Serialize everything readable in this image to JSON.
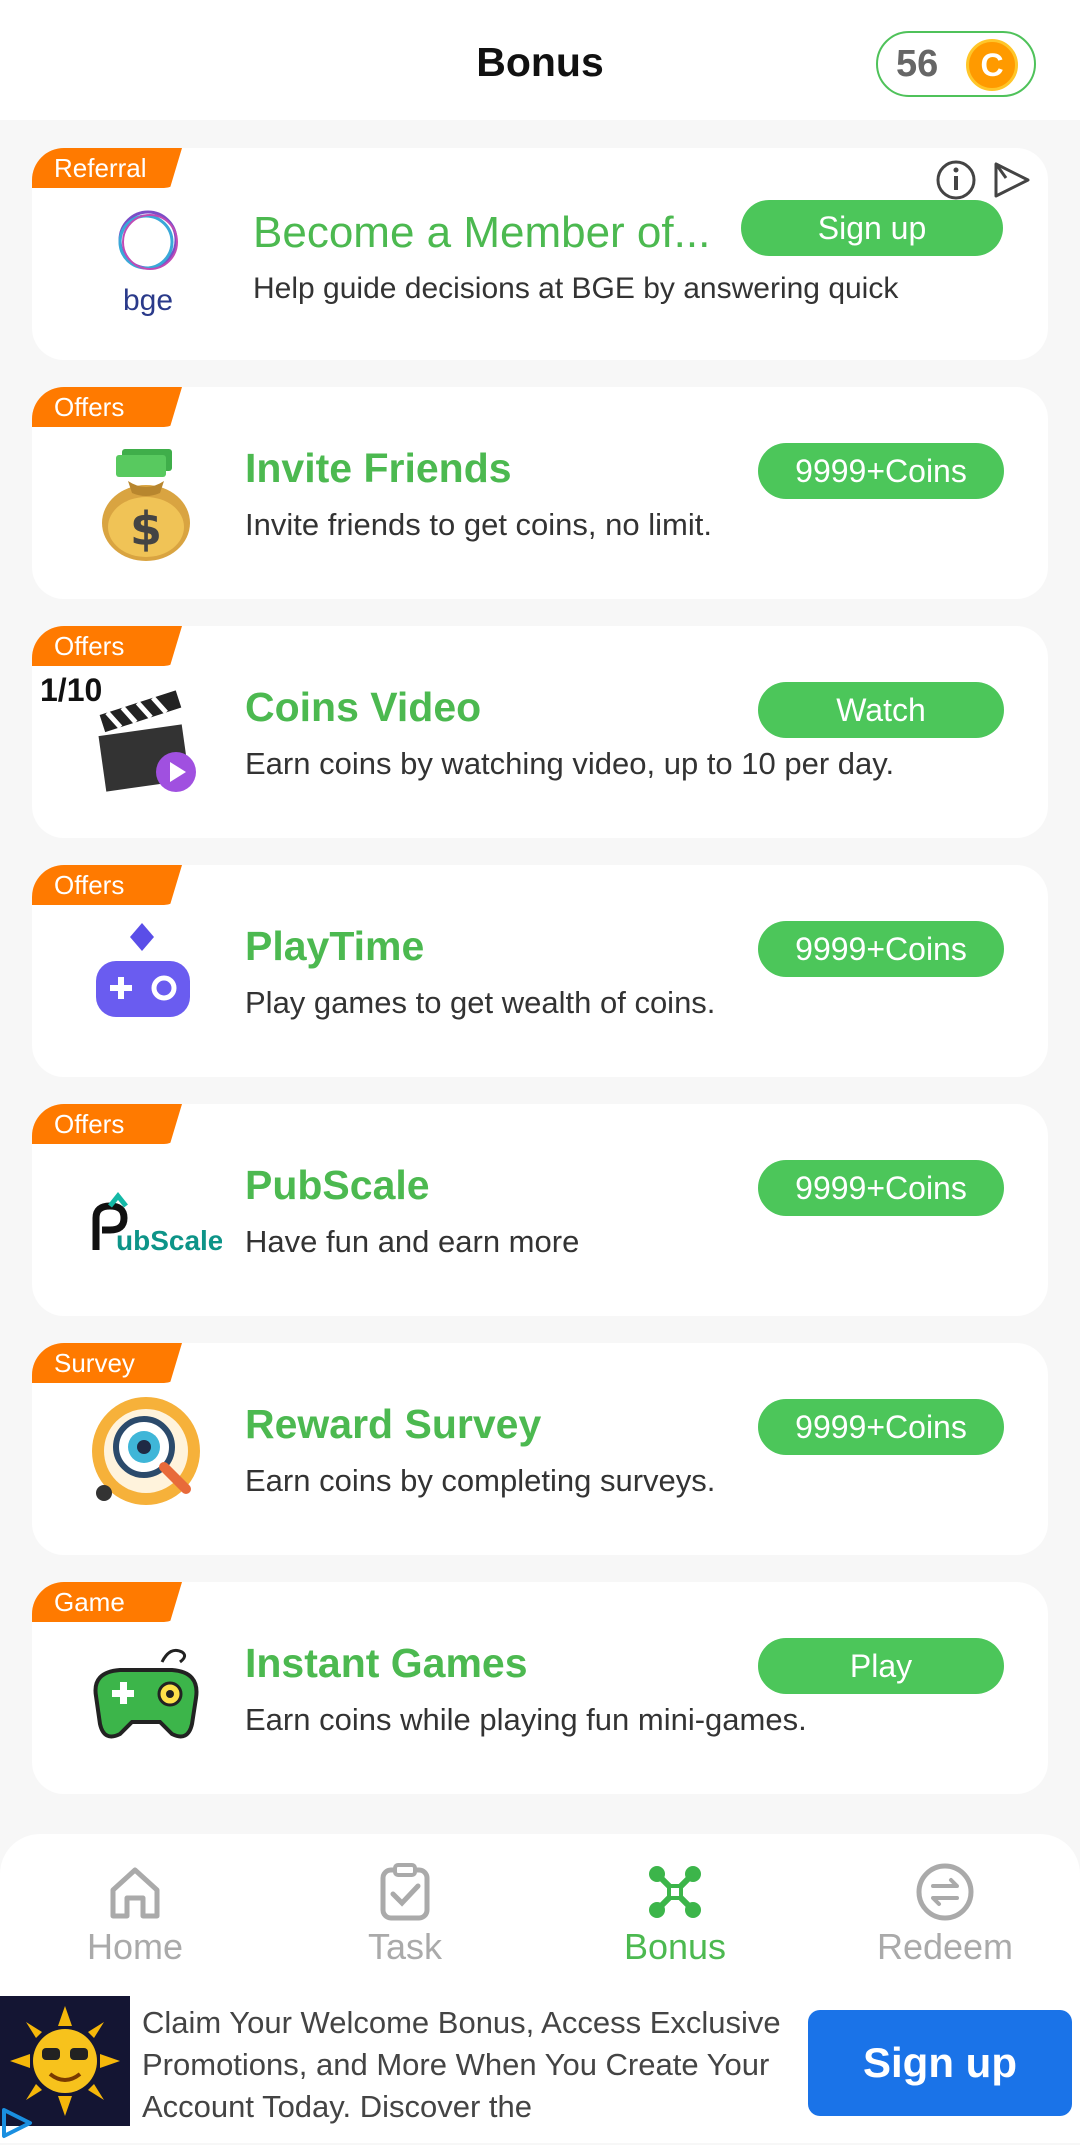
{
  "header": {
    "title": "Bonus",
    "coin_count": "56",
    "coin_symbol": "C"
  },
  "ad_card": {
    "tag": "Referral",
    "brand": "bge",
    "title": "Become a Member of...",
    "description": "Help guide decisions at BGE by answering quick",
    "button": "Sign up"
  },
  "cards": [
    {
      "tag": "Offers",
      "title": "Invite Friends",
      "description": "Invite friends to get coins, no limit.",
      "button": "9999+Coins",
      "icon": "money-bag-icon"
    },
    {
      "tag": "Offers",
      "title": "Coins Video",
      "description": "Earn coins by watching video, up to 10 per day.",
      "button": "Watch",
      "counter": "1/10",
      "icon": "clapperboard-icon"
    },
    {
      "tag": "Offers",
      "title": "PlayTime",
      "description": "Play games to get wealth of coins.",
      "button": "9999+Coins",
      "icon": "gamepad-icon"
    },
    {
      "tag": "Offers",
      "title": "PubScale",
      "description": "Have fun and earn more",
      "button": "9999+Coins",
      "icon": "pubscale-logo",
      "logo_text": "ubScale"
    },
    {
      "tag": "Survey",
      "title": "Reward Survey",
      "description": "Earn coins by completing surveys.",
      "button": "9999+Coins",
      "icon": "survey-magnifier-icon"
    },
    {
      "tag": "Game",
      "title": "Instant Games",
      "description": "Earn coins while playing fun mini-games.",
      "button": "Play",
      "icon": "green-gamepad-icon"
    }
  ],
  "nav": [
    {
      "label": "Home",
      "icon": "home-icon",
      "active": false
    },
    {
      "label": "Task",
      "icon": "clipboard-check-icon",
      "active": false
    },
    {
      "label": "Bonus",
      "icon": "bonus-network-icon",
      "active": true
    },
    {
      "label": "Redeem",
      "icon": "exchange-icon",
      "active": false
    }
  ],
  "banner": {
    "text": "Claim Your Welcome Bonus, Access Exclusive Promotions, and More When You Create Your Account Today. Discover the",
    "button": "Sign up"
  },
  "colors": {
    "accent": "#4cb950",
    "tag": "#ff7a00",
    "banner_button": "#1a73e8"
  }
}
